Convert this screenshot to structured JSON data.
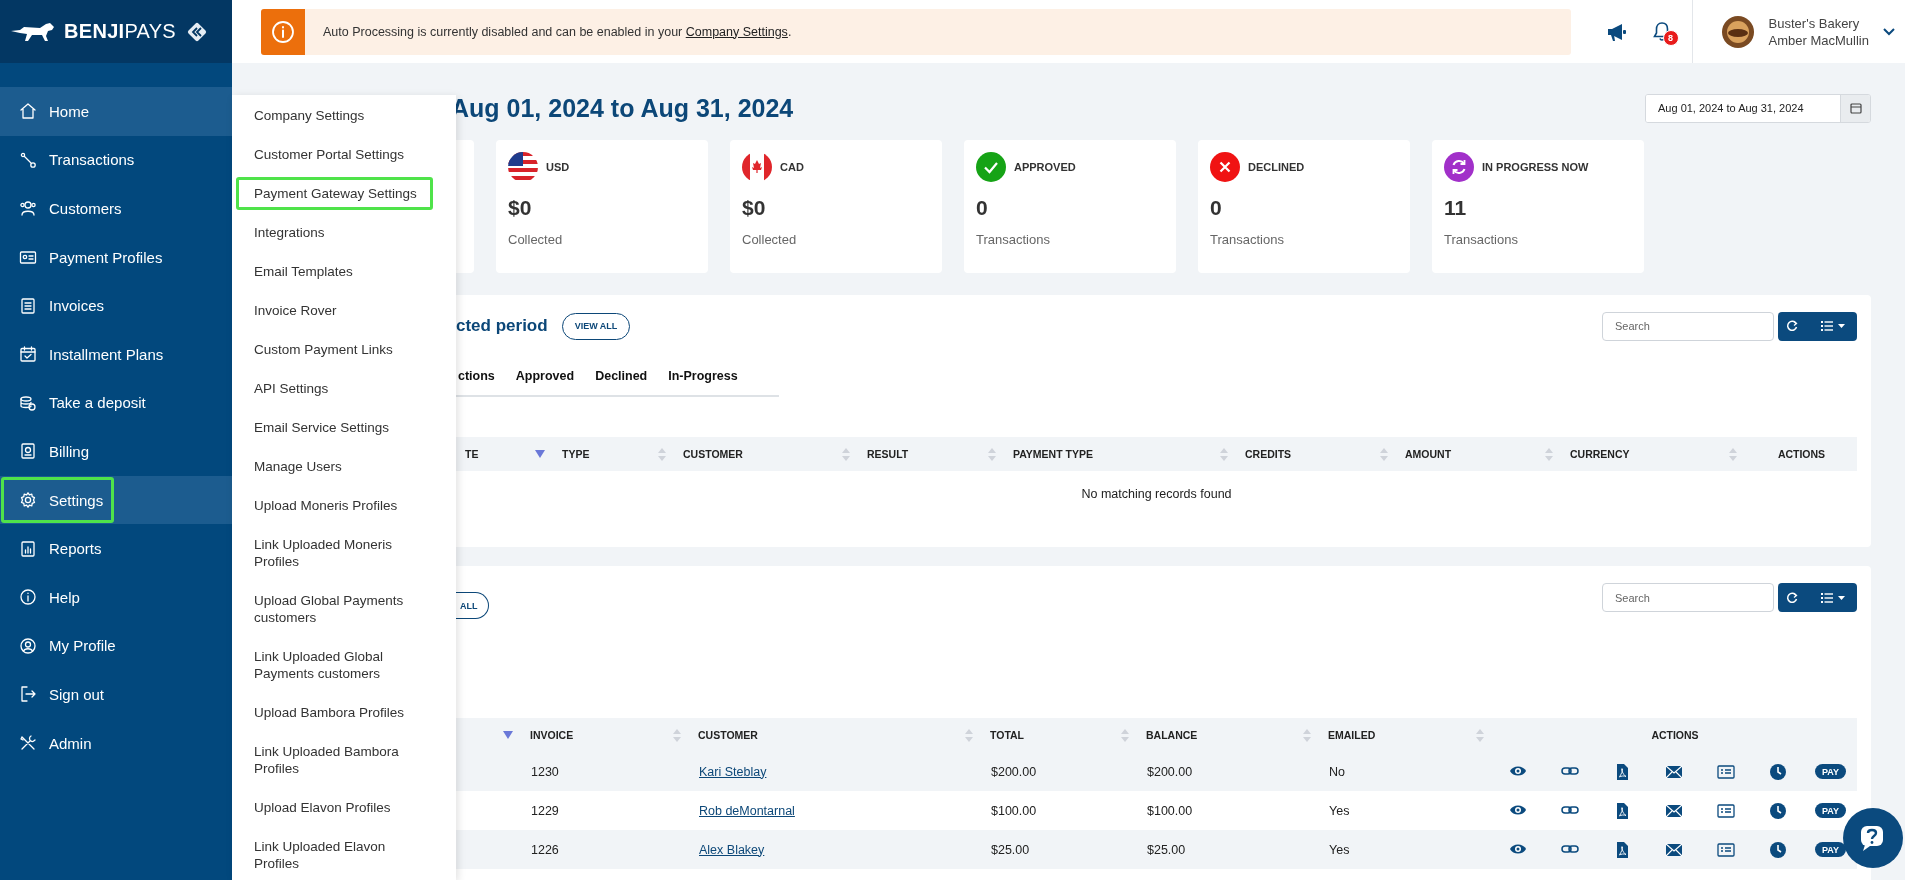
{
  "brand": {
    "name_bold": "BENJI",
    "name_light": "PAYS"
  },
  "sidebar": {
    "items": [
      {
        "label": "Home",
        "active": true,
        "outlined": false
      },
      {
        "label": "Transactions",
        "active": false,
        "outlined": false
      },
      {
        "label": "Customers",
        "active": false,
        "outlined": false
      },
      {
        "label": "Payment Profiles",
        "active": false,
        "outlined": false
      },
      {
        "label": "Invoices",
        "active": false,
        "outlined": false
      },
      {
        "label": "Installment Plans",
        "active": false,
        "outlined": false
      },
      {
        "label": "Take a deposit",
        "active": false,
        "outlined": false
      },
      {
        "label": "Billing",
        "active": false,
        "outlined": false
      },
      {
        "label": "Settings",
        "active": true,
        "outlined": true
      },
      {
        "label": "Reports",
        "active": false,
        "outlined": false
      },
      {
        "label": "Help",
        "active": false,
        "outlined": false
      },
      {
        "label": "My Profile",
        "active": false,
        "outlined": false
      },
      {
        "label": "Sign out",
        "active": false,
        "outlined": false
      },
      {
        "label": "Admin",
        "active": false,
        "outlined": false
      }
    ]
  },
  "notice": {
    "text": "Auto Processing is currently disabled and can be enabled in your ",
    "link": "Company Settings",
    "end": "."
  },
  "notifications": {
    "count": "8"
  },
  "account": {
    "business": "Buster's Bakery",
    "user": "Amber MacMullin"
  },
  "page_title": "Aug 01, 2024 to Aug 31, 2024",
  "date_range": {
    "value": "Aug 01, 2024 to Aug 31, 2024"
  },
  "stats": [
    {
      "kind": "usd",
      "label": "USD",
      "value": "$0",
      "caption": "Collected"
    },
    {
      "kind": "cad",
      "label": "CAD",
      "value": "$0",
      "caption": "Collected"
    },
    {
      "kind": "approved",
      "label": "APPROVED",
      "value": "0",
      "caption": "Transactions"
    },
    {
      "kind": "declined",
      "label": "DECLINED",
      "value": "0",
      "caption": "Transactions"
    },
    {
      "kind": "progress",
      "label": "IN PROGRESS NOW",
      "value": "11",
      "caption": "Transactions"
    }
  ],
  "transactions_panel": {
    "heading": "cted period",
    "view_all": "VIEW ALL",
    "search_placeholder": "Search",
    "tabs": [
      {
        "label": "ctions"
      },
      {
        "label": "Approved"
      },
      {
        "label": "Declined"
      },
      {
        "label": "In-Progress"
      }
    ],
    "columns": [
      {
        "label": "TE",
        "sortable": true,
        "sorted_descending": true
      },
      {
        "label": "TYPE",
        "sortable": true,
        "sorted_descending": false
      },
      {
        "label": "CUSTOMER",
        "sortable": true,
        "sorted_descending": false
      },
      {
        "label": "RESULT",
        "sortable": true,
        "sorted_descending": false
      },
      {
        "label": "PAYMENT TYPE",
        "sortable": true,
        "sorted_descending": false
      },
      {
        "label": "CREDITS",
        "sortable": true,
        "sorted_descending": false
      },
      {
        "label": "AMOUNT",
        "sortable": true,
        "sorted_descending": false
      },
      {
        "label": "CURRENCY",
        "sortable": true,
        "sorted_descending": false
      },
      {
        "label": "ACTIONS",
        "sortable": false,
        "sorted_descending": false
      }
    ],
    "empty_message": "No matching records found"
  },
  "invoices_panel": {
    "view_all": "ALL",
    "search_placeholder": "Search",
    "columns": [
      {
        "sortable": true,
        "sorted_descending": true
      },
      {
        "label": "INVOICE",
        "sortable": true,
        "sorted_descending": false
      },
      {
        "label": "CUSTOMER",
        "sortable": true,
        "sorted_descending": false
      },
      {
        "label": "TOTAL",
        "sortable": true,
        "sorted_descending": false
      },
      {
        "label": "BALANCE",
        "sortable": true,
        "sorted_descending": false
      },
      {
        "label": "EMAILED",
        "sortable": true,
        "sorted_descending": false
      },
      {
        "label": "ACTIONS",
        "sortable": false,
        "sorted_descending": false
      }
    ],
    "rows": [
      {
        "invoice": "1230",
        "customer": "Kari Steblay",
        "total": "$200.00",
        "balance": "$200.00",
        "emailed": "No",
        "pay": "PAY"
      },
      {
        "invoice": "1229",
        "customer": "Rob deMontarnal",
        "total": "$100.00",
        "balance": "$100.00",
        "emailed": "Yes",
        "pay": "PAY"
      },
      {
        "invoice": "1226",
        "customer": "Alex Blakey",
        "total": "$25.00",
        "balance": "$25.00",
        "emailed": "Yes",
        "pay": "PAY"
      }
    ]
  },
  "settings_menu": {
    "items": [
      {
        "label": "Company Settings",
        "outlined": false
      },
      {
        "label": "Customer Portal Settings",
        "outlined": false
      },
      {
        "label": "Payment Gateway Settings",
        "outlined": true
      },
      {
        "label": "Integrations",
        "outlined": false
      },
      {
        "label": "Email Templates",
        "outlined": false
      },
      {
        "label": "Invoice Rover",
        "outlined": false
      },
      {
        "label": "Custom Payment Links",
        "outlined": false
      },
      {
        "label": "API Settings",
        "outlined": false
      },
      {
        "label": "Email Service Settings",
        "outlined": false
      },
      {
        "label": "Manage Users",
        "outlined": false
      },
      {
        "label": "Upload Moneris Profiles",
        "outlined": false
      },
      {
        "label": "Link Uploaded Moneris Profiles",
        "outlined": false
      },
      {
        "label": "Upload Global Payments customers",
        "outlined": false
      },
      {
        "label": "Link Uploaded Global Payments customers",
        "outlined": false
      },
      {
        "label": "Upload Bambora Profiles",
        "outlined": false
      },
      {
        "label": "Link Uploaded Bambora Profiles",
        "outlined": false
      },
      {
        "label": "Upload Elavon Profiles",
        "outlined": false
      },
      {
        "label": "Link Uploaded Elavon Profiles",
        "outlined": false
      }
    ]
  }
}
